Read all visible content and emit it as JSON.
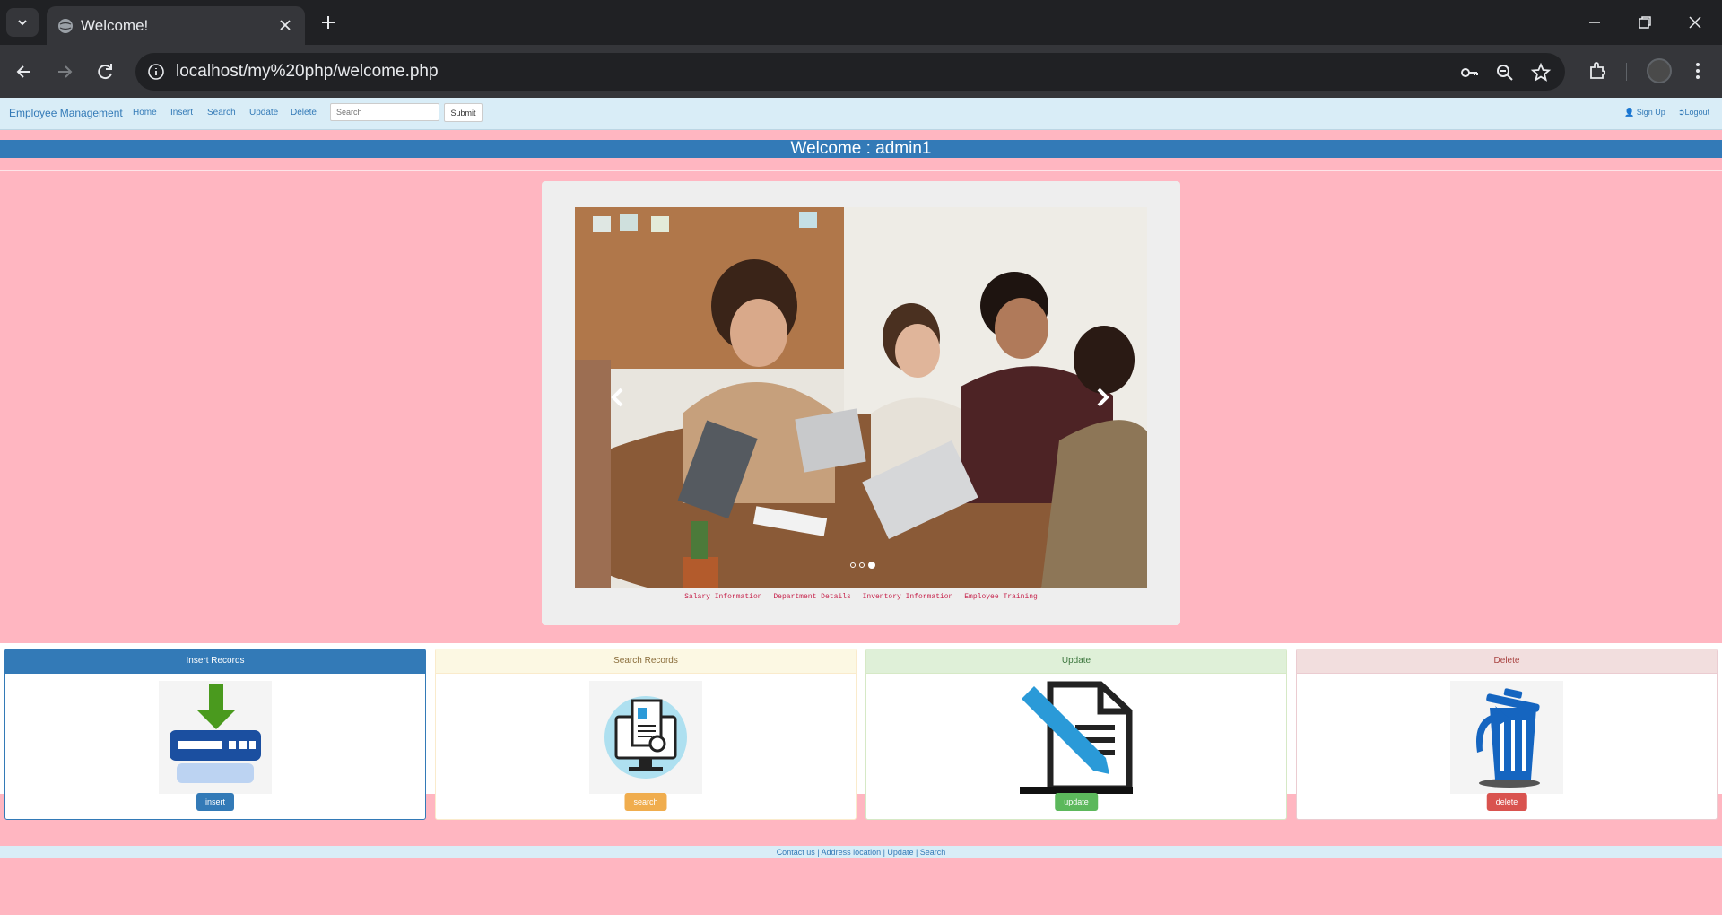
{
  "browser": {
    "tab_title": "Welcome!",
    "url": "localhost/my%20php/welcome.php"
  },
  "navbar": {
    "brand": "Employee Management",
    "links": [
      "Home",
      "Insert",
      "Search",
      "Update",
      "Delete"
    ],
    "search_placeholder": "Search",
    "submit_label": "Submit",
    "signup_label": "Sign Up",
    "logout_label": "Logout"
  },
  "welcome": {
    "text": "Welcome : admin1"
  },
  "carousel": {
    "slide_count": 3,
    "active_slide": 3,
    "captions": [
      "Salary Information",
      "Department Details",
      "Inventory Information",
      "Employee Training"
    ]
  },
  "cards": [
    {
      "title": "Insert Records",
      "button": "insert",
      "icon": "insert-database-icon",
      "header_bg": "#337ab7",
      "header_color": "#ffffff",
      "border": "#337ab7",
      "button_bg": "#337ab7"
    },
    {
      "title": "Search Records",
      "button": "search",
      "icon": "search-records-icon",
      "header_bg": "#fcf8e3",
      "header_color": "#8a6d3b",
      "border": "#faebcc",
      "button_bg": "#f0ad4e"
    },
    {
      "title": "Update",
      "button": "update",
      "icon": "edit-document-icon",
      "header_bg": "#dff0d8",
      "header_color": "#3c763d",
      "border": "#d6e9c6",
      "button_bg": "#5cb85c"
    },
    {
      "title": "Delete",
      "button": "delete",
      "icon": "trash-icon",
      "header_bg": "#f2dede",
      "header_color": "#a94442",
      "border": "#ebccd1",
      "button_bg": "#d9534f"
    }
  ],
  "footer": {
    "text": "Contact us | Address location | Update | Search"
  },
  "colors": {
    "page_bg": "#ffb6c1",
    "navbar_bg": "#d9edf7",
    "primary": "#337ab7"
  }
}
